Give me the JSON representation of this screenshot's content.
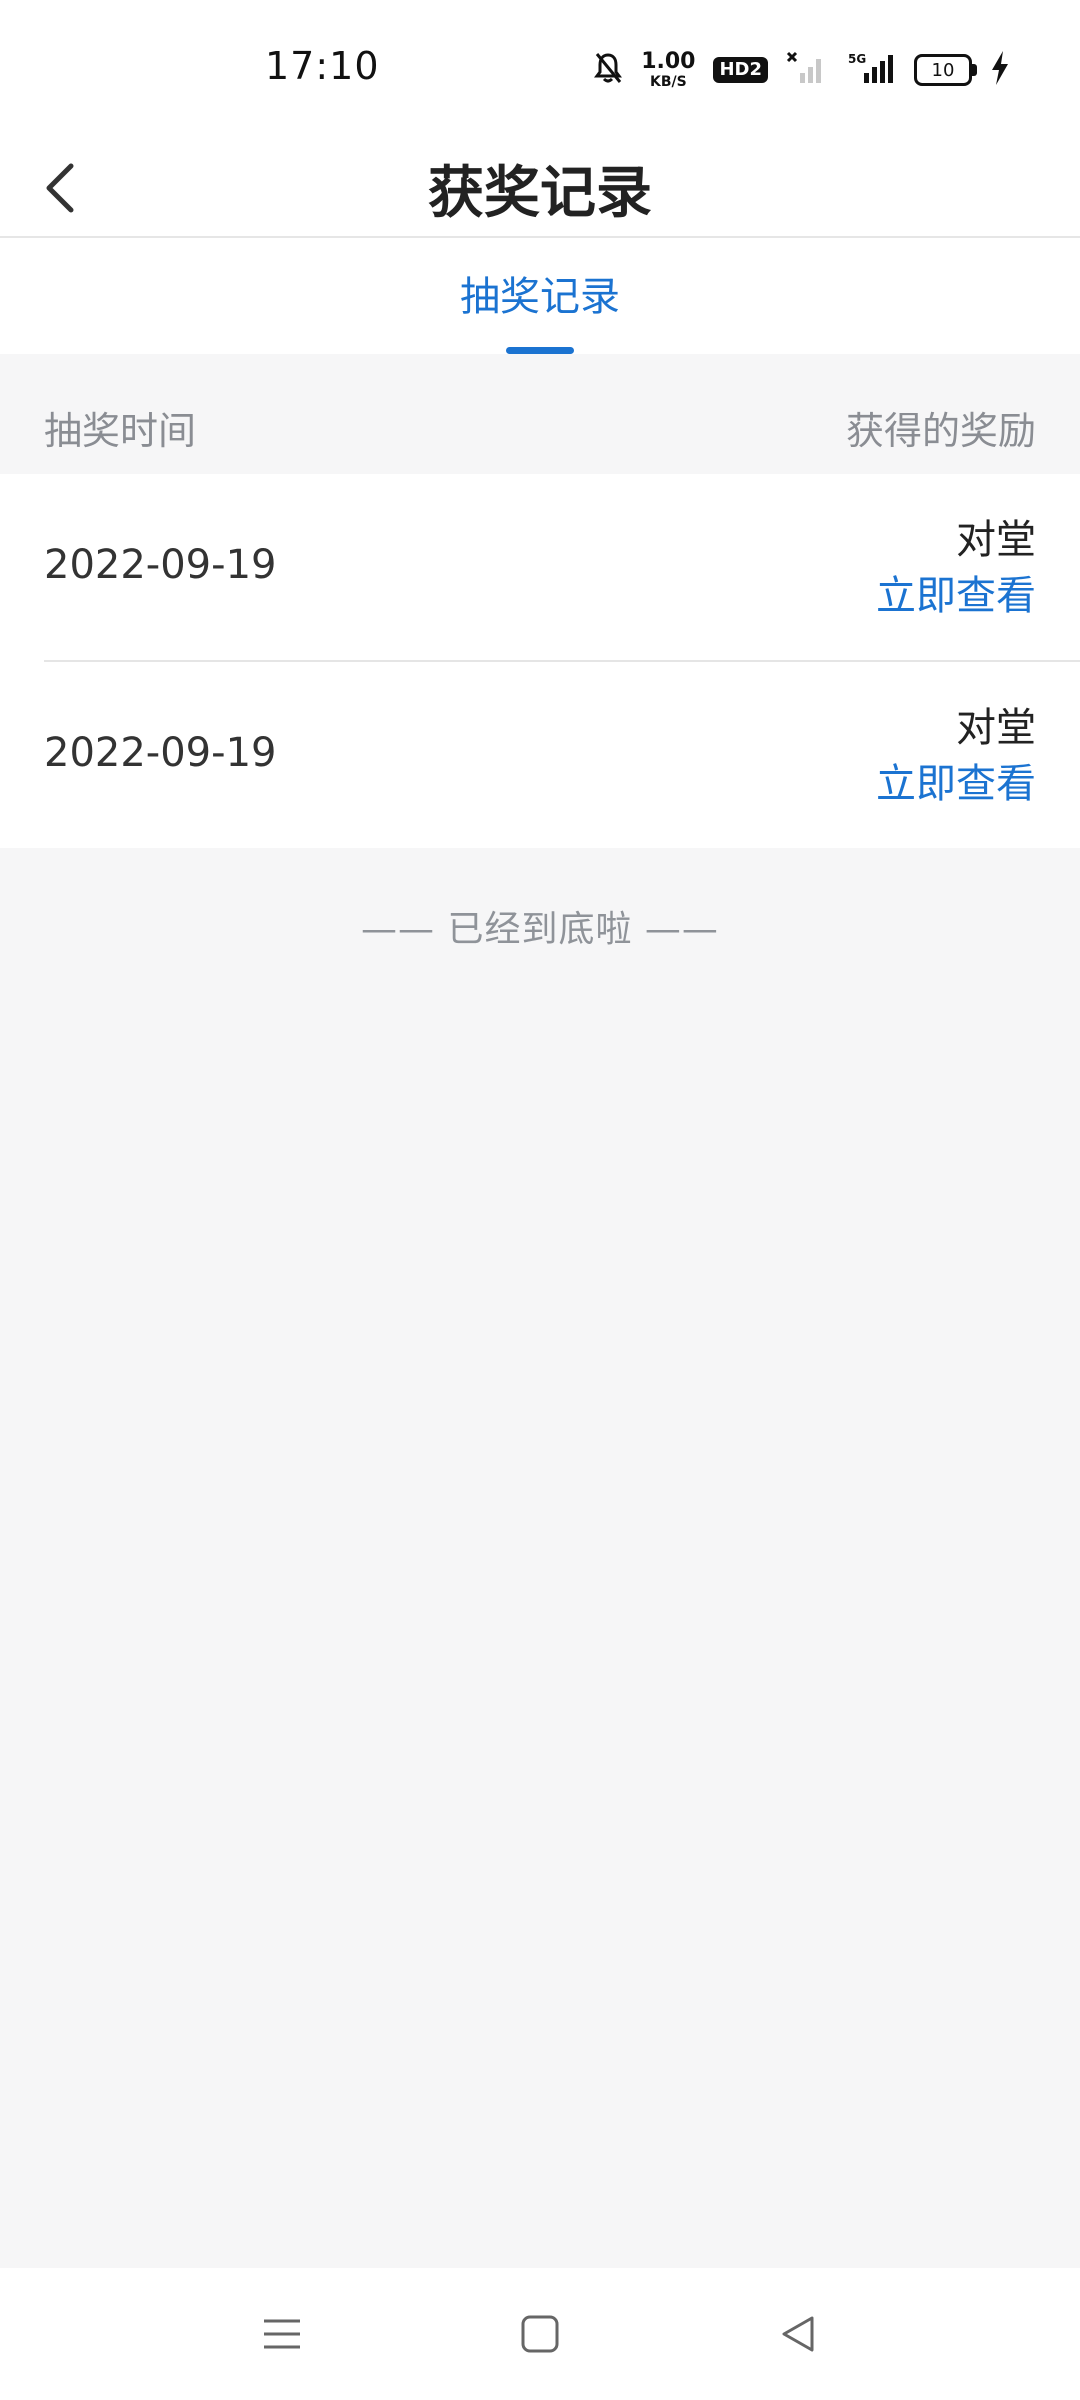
{
  "status_bar": {
    "time": "17:10",
    "net_speed_value": "1.00",
    "net_speed_unit": "KB/S",
    "hd_label": "HD2",
    "battery_level": "10"
  },
  "header": {
    "title": "获奖记录"
  },
  "tabs": [
    {
      "label": "抽奖记录",
      "active": true
    }
  ],
  "columns": {
    "left": "抽奖时间",
    "right": "获得的奖励"
  },
  "records": [
    {
      "date": "2022-09-19",
      "reward": "对堂",
      "action": "立即查看"
    },
    {
      "date": "2022-09-19",
      "reward": "对堂",
      "action": "立即查看"
    }
  ],
  "end_text": "—— 已经到底啦 ——",
  "colors": {
    "accent": "#1b73d1",
    "background": "#f6f6f7"
  }
}
